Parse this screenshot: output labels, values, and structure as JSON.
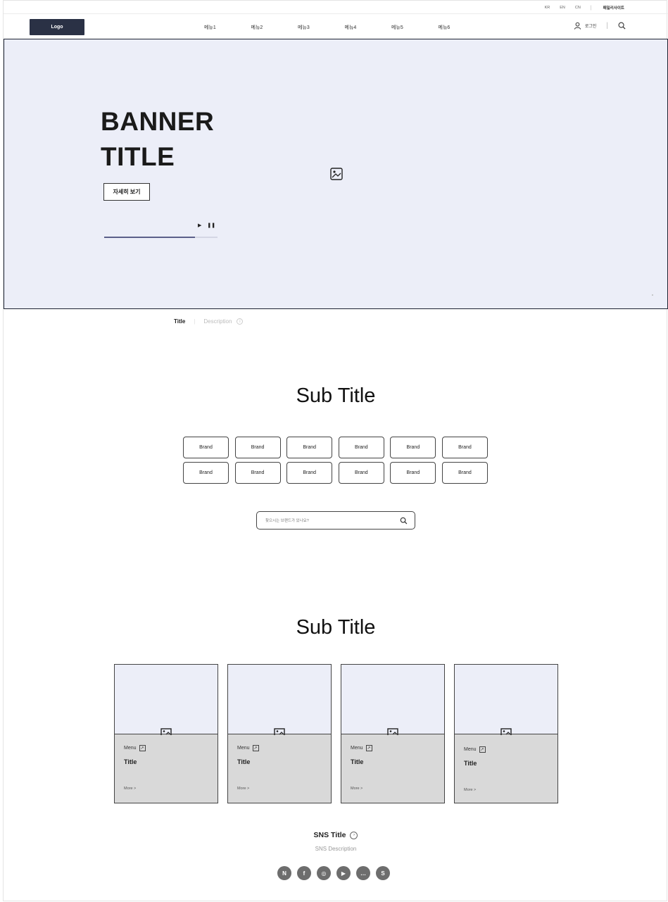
{
  "utility": {
    "languages": [
      "KR",
      "EN",
      "CN"
    ],
    "family_site": "패밀리사이트"
  },
  "header": {
    "logo": "Logo",
    "menu": [
      "메뉴1",
      "메뉴2",
      "메뉴3",
      "메뉴4",
      "메뉴5",
      "메뉴6"
    ],
    "login": "로그인"
  },
  "banner": {
    "title_line1": "BANNER",
    "title_line2": "TITLE",
    "button": "자세히 보기",
    "play": "▶",
    "pause": "❚❚",
    "progress": 0.8
  },
  "title_strip": {
    "title": "Title",
    "description": "Description",
    "info": "i"
  },
  "brand_section": {
    "subtitle": "Sub Title",
    "brands": [
      "Brand",
      "Brand",
      "Brand",
      "Brand",
      "Brand",
      "Brand",
      "Brand",
      "Brand",
      "Brand",
      "Brand",
      "Brand",
      "Brand"
    ],
    "search_placeholder": "찾으시는 브랜드가 있나요?"
  },
  "card_section": {
    "subtitle": "Sub Title",
    "cards": [
      {
        "menu": "Menu",
        "title": "Title",
        "more": "More >"
      },
      {
        "menu": "Menu",
        "title": "Title",
        "more": "More >"
      },
      {
        "menu": "Menu",
        "title": "Title",
        "more": "More >"
      },
      {
        "menu": "Menu",
        "title": "Title",
        "more": "More >"
      }
    ]
  },
  "sns": {
    "title": "SNS Title",
    "description": "SNS Description",
    "icons": [
      {
        "name": "naver-icon",
        "glyph": "N"
      },
      {
        "name": "facebook-icon",
        "glyph": "f"
      },
      {
        "name": "instagram-icon",
        "glyph": "◎"
      },
      {
        "name": "youtube-icon",
        "glyph": "▶"
      },
      {
        "name": "talk-icon",
        "glyph": "…"
      },
      {
        "name": "story-icon",
        "glyph": "S"
      }
    ]
  }
}
